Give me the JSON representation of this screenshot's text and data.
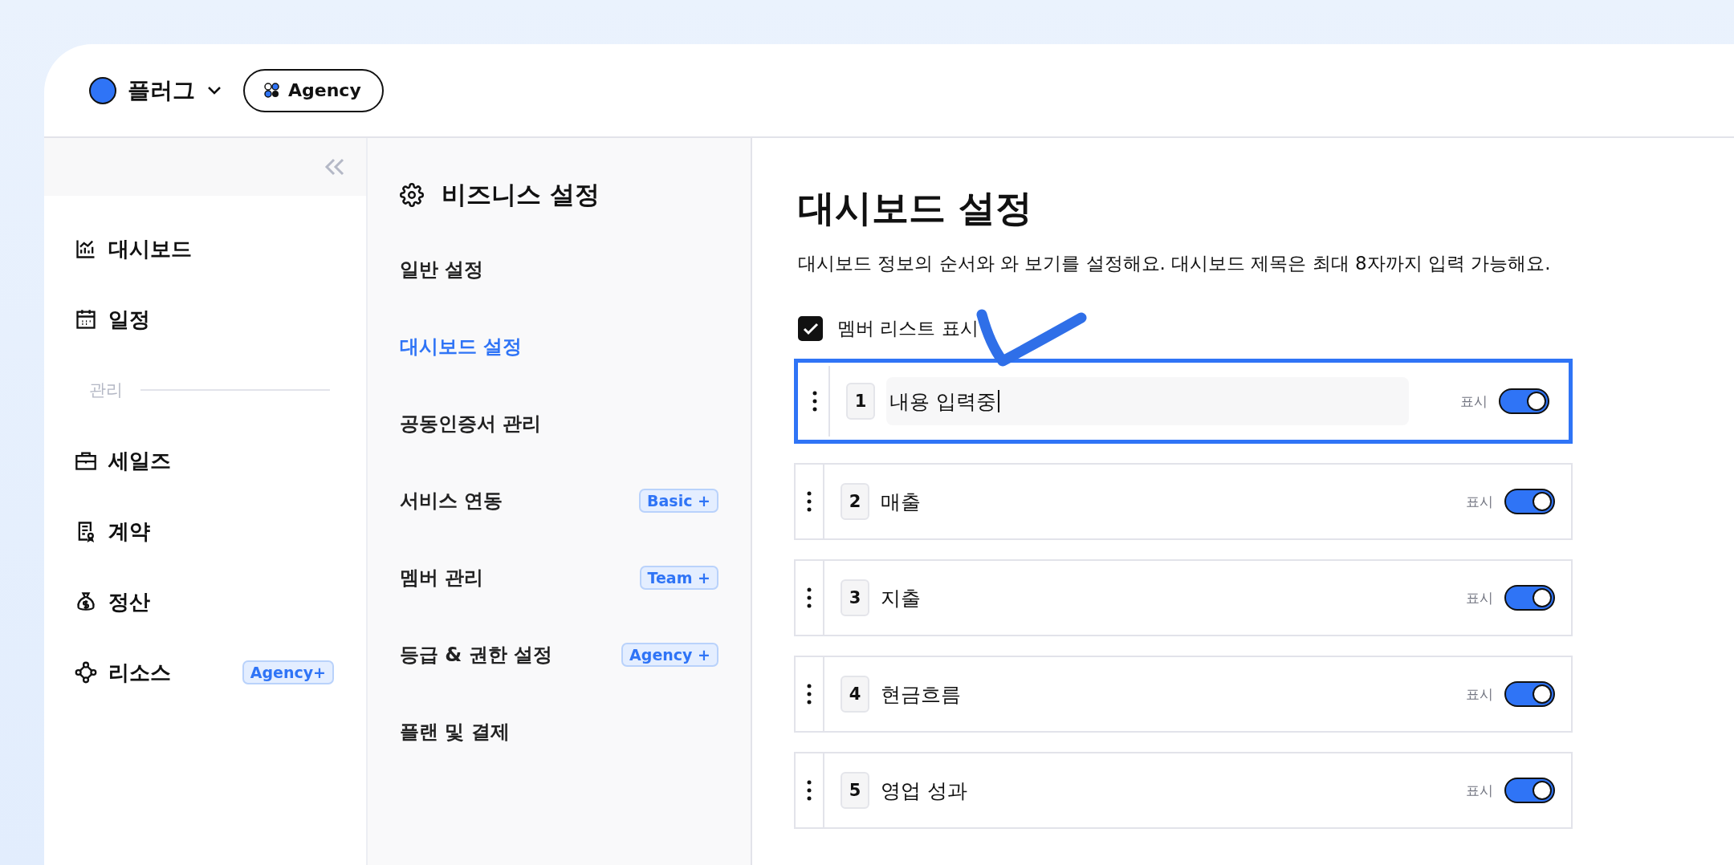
{
  "workspace": {
    "name": "플러그",
    "plan": "Agency"
  },
  "sidebar": {
    "items": [
      {
        "label": "대시보드",
        "selected": false
      },
      {
        "label": "일정",
        "selected": false
      }
    ],
    "section": {
      "title": "관리",
      "items": [
        {
          "label": "세일즈",
          "selected": false
        },
        {
          "label": "계약",
          "selected": false
        },
        {
          "label": "정산",
          "selected": false
        },
        {
          "label": "리소스",
          "selected": false,
          "badge": "Agency+"
        }
      ]
    }
  },
  "settings_menu": {
    "title": "비즈니스 설정",
    "items": [
      {
        "label": "일반 설정",
        "selected": false
      },
      {
        "label": "대시보드 설정",
        "selected": true
      },
      {
        "label": "공동인증서 관리",
        "selected": false
      },
      {
        "label": "서비스 연동",
        "selected": false,
        "badge": "Basic +"
      },
      {
        "label": "멤버 관리",
        "selected": false,
        "badge": "Team +"
      },
      {
        "label": "등급 & 권한 설정",
        "selected": false,
        "badge": "Agency +"
      },
      {
        "label": "플랜 및 결제",
        "selected": false
      }
    ]
  },
  "page": {
    "title": "대시보드 설정",
    "description": "대시보드 정보의 순서와 와 보기를 설정해요. 대시보드 제목은 최대 8자까지 입력 가능해요.",
    "member_list": {
      "label": "멤버 리스트 표시",
      "checked": true
    },
    "rows": [
      {
        "number": "1",
        "title": "내용 입력중",
        "editing": true,
        "toggle_label": "표시",
        "on": true
      },
      {
        "number": "2",
        "title": "매출",
        "editing": false,
        "toggle_label": "표시",
        "on": true
      },
      {
        "number": "3",
        "title": "지출",
        "editing": false,
        "toggle_label": "표시",
        "on": true
      },
      {
        "number": "4",
        "title": "현금흐름",
        "editing": false,
        "toggle_label": "표시",
        "on": true
      },
      {
        "number": "5",
        "title": "영업 성과",
        "editing": false,
        "toggle_label": "표시",
        "on": true
      }
    ]
  }
}
